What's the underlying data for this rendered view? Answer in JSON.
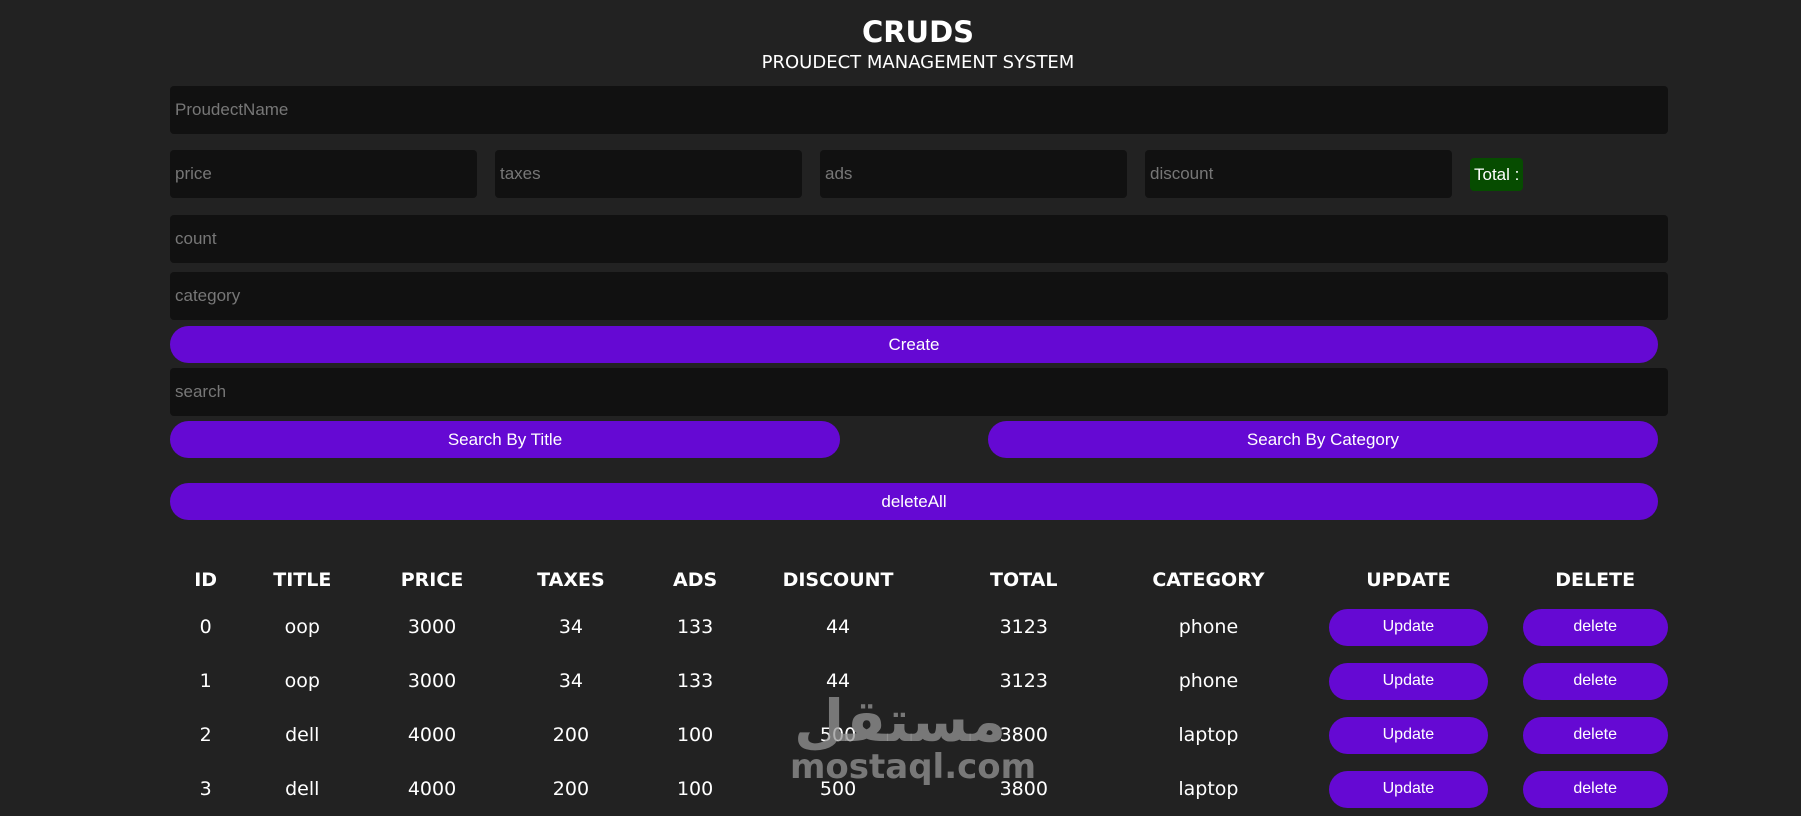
{
  "header": {
    "title": "CRUDS",
    "subtitle": "PROUDECT MANAGEMENT SYSTEM"
  },
  "form": {
    "product_name_placeholder": "ProudectName",
    "price_placeholder": "price",
    "taxes_placeholder": "taxes",
    "ads_placeholder": "ads",
    "discount_placeholder": "discount",
    "total_label": "Total :",
    "count_placeholder": "count",
    "category_placeholder": "category",
    "create_label": "Create"
  },
  "search": {
    "placeholder": "search",
    "by_title_label": "Search By Title",
    "by_category_label": "Search By Category",
    "delete_all_label": "deleteAll"
  },
  "table": {
    "headers": [
      "ID",
      "TITLE",
      "PRICE",
      "TAXES",
      "ADS",
      "DISCOUNT",
      "TOTAL",
      "CATEGORY",
      "UPDATE",
      "DELETE"
    ],
    "update_label": "Update",
    "delete_label": "delete",
    "rows": [
      {
        "id": "0",
        "title": "oop",
        "price": "3000",
        "taxes": "34",
        "ads": "133",
        "discount": "44",
        "total": "3123",
        "category": "phone"
      },
      {
        "id": "1",
        "title": "oop",
        "price": "3000",
        "taxes": "34",
        "ads": "133",
        "discount": "44",
        "total": "3123",
        "category": "phone"
      },
      {
        "id": "2",
        "title": "dell",
        "price": "4000",
        "taxes": "200",
        "ads": "100",
        "discount": "500",
        "total": "3800",
        "category": "laptop"
      },
      {
        "id": "3",
        "title": "dell",
        "price": "4000",
        "taxes": "200",
        "ads": "100",
        "discount": "500",
        "total": "3800",
        "category": "laptop"
      }
    ]
  },
  "watermark": {
    "arabic": "مستقل",
    "latin": "mostaql.com"
  },
  "colors": {
    "background": "#222222",
    "input_bg": "#111111",
    "button": "#6509d3",
    "total_bg": "#064c00"
  }
}
